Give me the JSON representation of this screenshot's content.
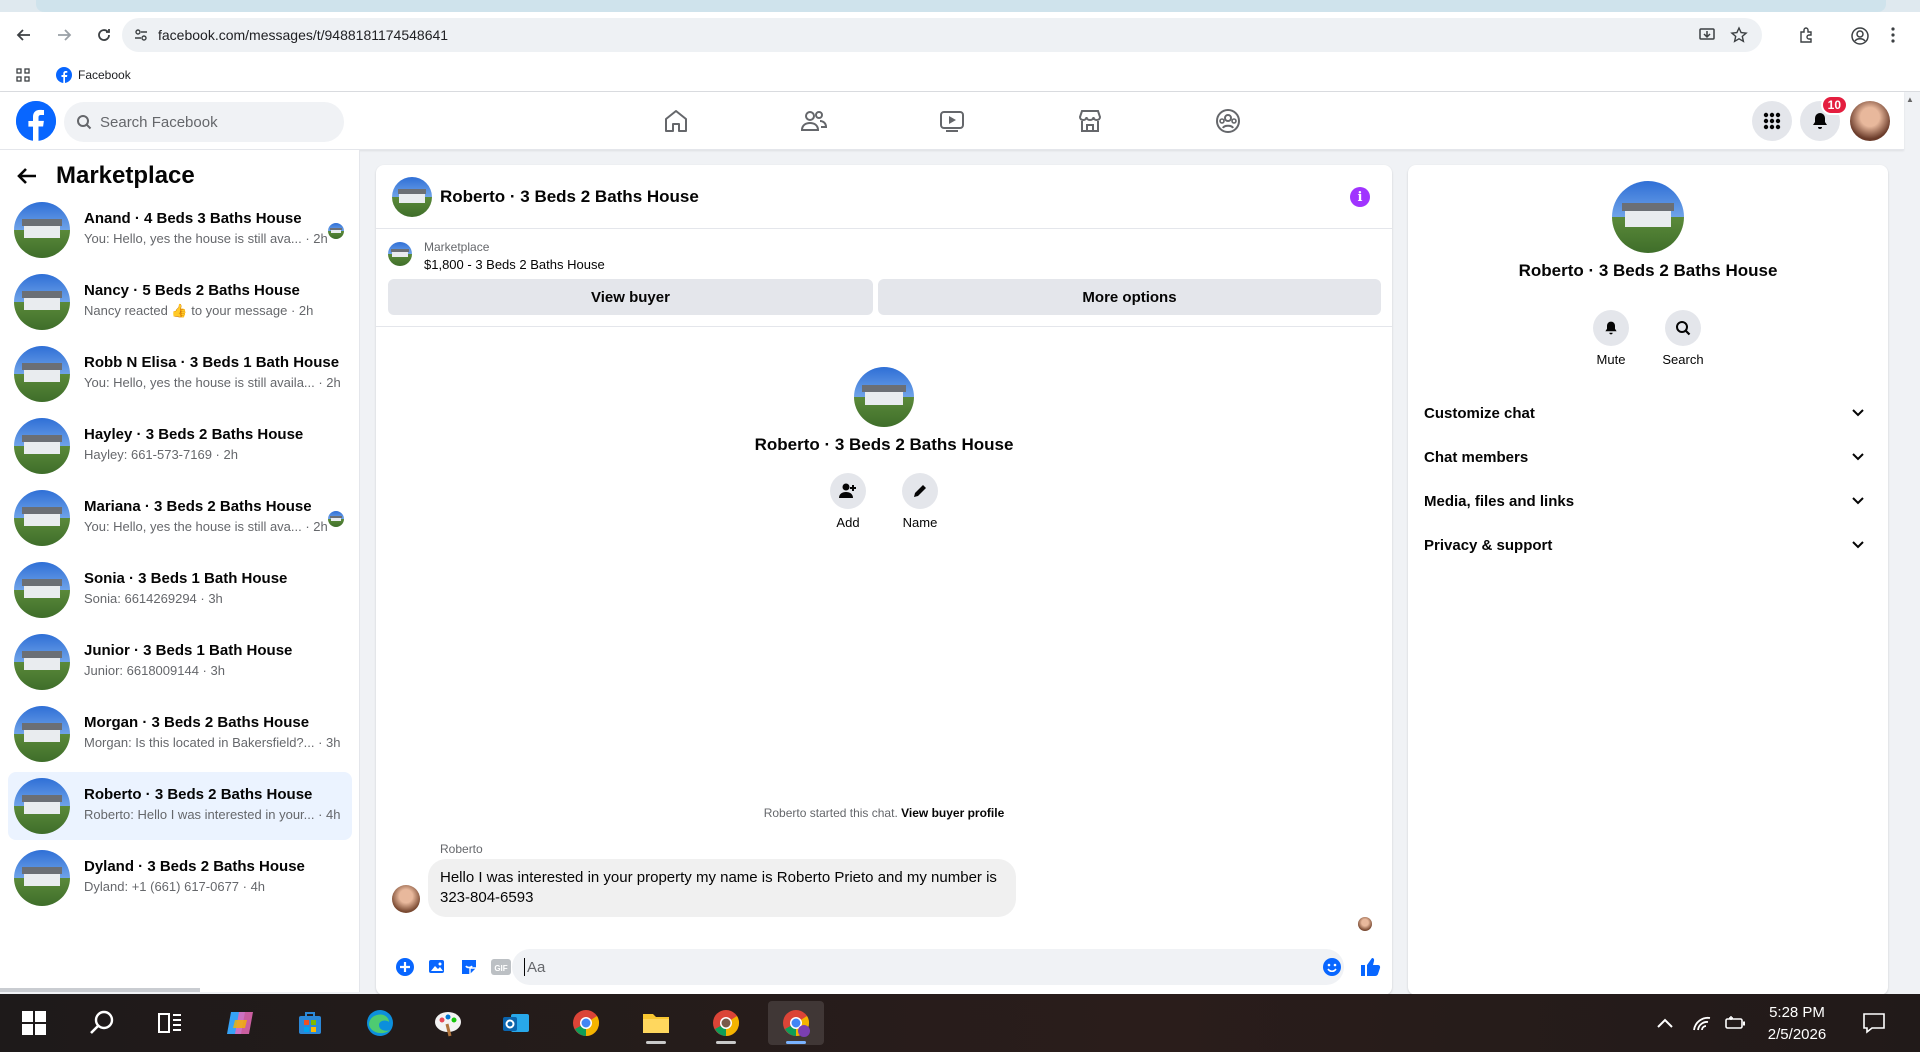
{
  "browser": {
    "url": "facebook.com/messages/t/9488181174548641",
    "bookmark_label": "Facebook"
  },
  "header": {
    "search_placeholder": "Search Facebook",
    "notification_count": "10",
    "nav_icons": [
      "home-icon",
      "friends-icon",
      "video-icon",
      "marketplace-icon",
      "groups-icon"
    ]
  },
  "sidebar": {
    "title": "Marketplace",
    "conversations": [
      {
        "title": "Anand · 4 Beds 3 Baths House",
        "subtitle": "You: Hello, yes the house is still ava... · 2h",
        "seen": true
      },
      {
        "title": "Nancy · 5 Beds 2 Baths House",
        "subtitle": "Nancy reacted 👍 to your message · 2h",
        "seen": false
      },
      {
        "title": "Robb N Elisa · 3 Beds 1 Bath House",
        "subtitle": "You: Hello, yes the house is still availa... · 2h",
        "seen": false
      },
      {
        "title": "Hayley · 3 Beds 2 Baths House",
        "subtitle": "Hayley: 661-573-7169 · 2h",
        "seen": false
      },
      {
        "title": "Mariana · 3 Beds 2 Baths House",
        "subtitle": "You: Hello, yes the house is still ava... · 2h",
        "seen": true
      },
      {
        "title": "Sonia · 3 Beds 1 Bath House",
        "subtitle": "Sonia: 6614269294 · 3h",
        "seen": false
      },
      {
        "title": "Junior · 3 Beds 1 Bath House",
        "subtitle": "Junior: 6618009144 · 3h",
        "seen": false
      },
      {
        "title": "Morgan · 3 Beds 2 Baths House",
        "subtitle": "Morgan: Is this located in Bakersfield?... · 3h",
        "seen": false
      },
      {
        "title": "Roberto · 3 Beds 2 Baths House",
        "subtitle": "Roberto: Hello I was interested in your... · 4h",
        "seen": false,
        "active": true
      },
      {
        "title": "Dyland · 3 Beds 2 Baths House",
        "subtitle": "Dyland: +1 (661) 617-0677 · 4h",
        "seen": false
      }
    ]
  },
  "chat": {
    "title": "Roberto · 3 Beds 2 Baths House",
    "marketplace_label": "Marketplace",
    "listing": "$1,800 - 3 Beds 2 Baths House",
    "view_buyer": "View buyer",
    "more_options": "More options",
    "intro_name": "Roberto · 3 Beds 2 Baths House",
    "add_label": "Add",
    "name_label": "Name",
    "started_text": "Roberto started this chat.",
    "view_profile": "View buyer profile",
    "sender": "Roberto",
    "message": "Hello I was interested in your property my name is Roberto Prieto and my number is 323-804-6593",
    "composer_placeholder": "Aa"
  },
  "details": {
    "name": "Roberto · 3 Beds 2 Baths House",
    "mute": "Mute",
    "search": "Search",
    "sections": [
      "Customize chat",
      "Chat members",
      "Media, files and links",
      "Privacy & support"
    ]
  },
  "taskbar": {
    "time": "5:28 PM",
    "date": "2/5/2026"
  },
  "colors": {
    "fb_blue": "#0866ff",
    "info_purple": "#a033ff",
    "badge_red": "#e41e3f",
    "active_row": "#ebf3ff"
  }
}
